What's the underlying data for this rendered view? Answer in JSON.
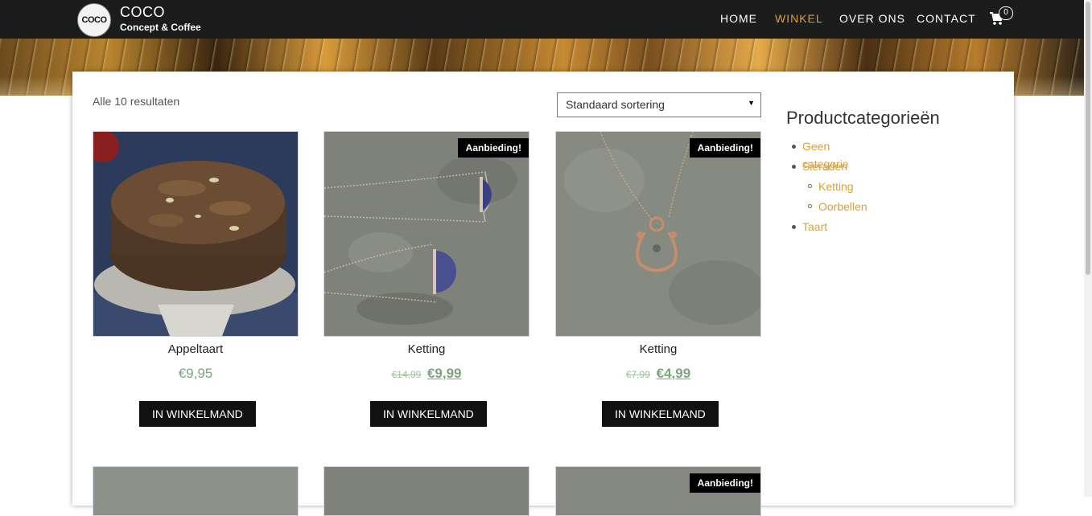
{
  "header": {
    "logo_text": "COCO",
    "brand_name": "COCO",
    "brand_tagline": "Concept & Coffee",
    "nav": [
      {
        "label": "HOME",
        "active": false
      },
      {
        "label": "WINKEL",
        "active": true
      },
      {
        "label": "OVER ONS",
        "active": false
      },
      {
        "label": "CONTACT",
        "active": false
      }
    ],
    "cart_count": "0",
    "accent_color": "#d9a13a"
  },
  "shop": {
    "result_count": "Alle 10 resultaten",
    "sort_selected": "Standaard sortering",
    "sale_badge": "Aanbieding!",
    "add_to_cart_label": "IN WINKELMAND",
    "products": [
      {
        "title": "Appeltaart",
        "price": "€9,95",
        "old_price": "",
        "on_sale": false
      },
      {
        "title": "Ketting",
        "price": "€9,99",
        "old_price": "€14,99",
        "on_sale": true
      },
      {
        "title": "Ketting",
        "price": "€4,99",
        "old_price": "€7,99",
        "on_sale": true
      }
    ],
    "price_color": "#7aa679"
  },
  "sidebar": {
    "title": "Productcategorieën",
    "categories": [
      {
        "label": "Geen categorie",
        "children": []
      },
      {
        "label": "Sieraden",
        "children": [
          {
            "label": "Ketting"
          },
          {
            "label": "Oorbellen"
          }
        ]
      },
      {
        "label": "Taart",
        "children": []
      }
    ]
  }
}
